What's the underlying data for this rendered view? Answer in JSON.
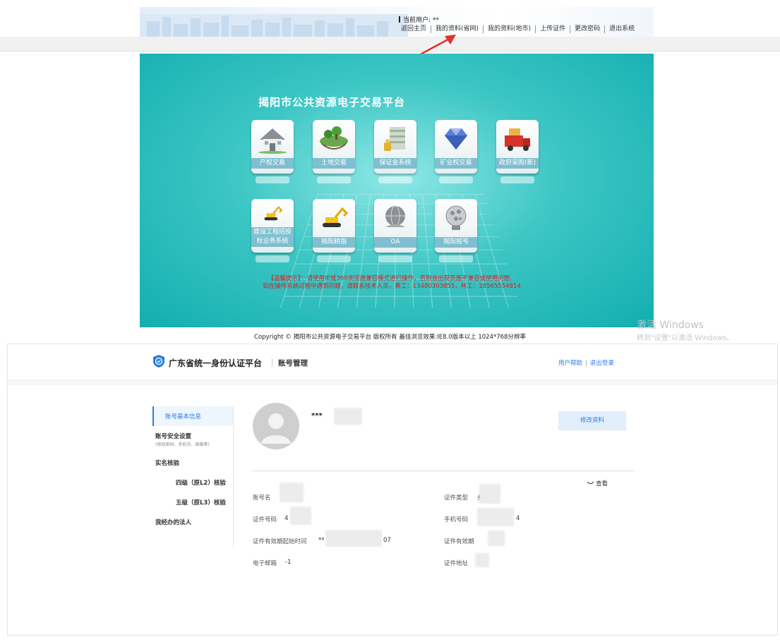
{
  "portal": {
    "current_user": "当前用户: **",
    "nav": [
      "返回主页",
      "我的资料(省网)",
      "我的资料(地市)",
      "上传证件",
      "更改密码",
      "退出系统"
    ],
    "title": "揭阳市公共资源电子交易平台",
    "tiles": [
      {
        "label": "产权交易",
        "icon": "house-icon"
      },
      {
        "label": "土地交易",
        "icon": "land-icon"
      },
      {
        "label": "保证金系统",
        "icon": "money-icon"
      },
      {
        "label": "矿业权交易",
        "icon": "diamond-icon"
      },
      {
        "label": "政府采购(新)",
        "icon": "truck-icon"
      },
      {
        "label": "建设工程招投标业务系统",
        "icon": "excavator-icon"
      },
      {
        "label": "揭阳耕指",
        "icon": "excavator-icon"
      },
      {
        "label": "OA",
        "icon": "globe-icon"
      },
      {
        "label": "揭阳摇号",
        "icon": "lottery-icon"
      }
    ],
    "warning_line1": "【温馨提示】：请使用IE或360浏览器兼容模式进行操作，否则会出现页面不兼容或使用问题。",
    "warning_line2": "如在操作系统过程中遇到问题，请联系技术人员，黄工：13480303855，林工：18565554814",
    "copyright": "Copyright © 揭阳市公共资源电子交易平台 版权所有 最佳浏览效果:IE8.0版本以上 1024*768分辨率",
    "activate_title": "激活 Windows",
    "activate_sub": "转到\"设置\"以激活 Windows。"
  },
  "account": {
    "brand": "广东省统一身份认证平台",
    "section": "账号管理",
    "help": "用户帮助",
    "logout": "退出登录",
    "sidebar": [
      {
        "label": "账号基本信息",
        "sub": "",
        "active": true
      },
      {
        "label": "账号安全设置",
        "sub": "(修改密码、手机号、邮箱等)"
      },
      {
        "label": "实名核验",
        "sub": ""
      },
      {
        "label": "四级（原L2）核验",
        "sub": ""
      },
      {
        "label": "五级（原L3）核验",
        "sub": ""
      },
      {
        "label": "我经办的法人",
        "sub": ""
      }
    ],
    "user_name": "***",
    "edit_button": "修改资料",
    "view_label": "查看",
    "fields": {
      "account_name_label": "账号名",
      "id_type_label": "证件类型",
      "id_type_value": "身",
      "id_no_label": "证件号码",
      "id_no_value": "4",
      "phone_label": "手机号码",
      "phone_value": "4",
      "valid_start_label": "证件有效期起始时间",
      "valid_start_prefix": "**",
      "valid_start_suffix": "07",
      "valid_label": "证件有效期",
      "email_label": "电子邮箱",
      "email_value": "-1",
      "address_label": "证件地址"
    }
  }
}
